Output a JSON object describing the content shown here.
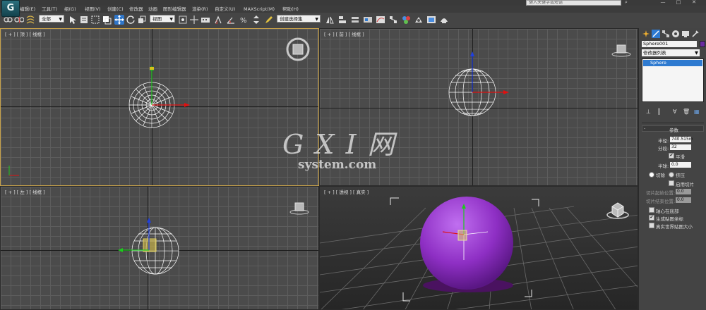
{
  "titlebar": {
    "search_placeholder": "键入关键字或短语",
    "win_min": "—",
    "win_max": "□",
    "win_close": "✕"
  },
  "menu": [
    "编辑(E)",
    "工具(T)",
    "组(G)",
    "视图(V)",
    "创建(C)",
    "修改器",
    "动画",
    "图形编辑器",
    "渲染(R)",
    "自定义(U)",
    "MAXScript(M)",
    "帮助(H)"
  ],
  "toolbar": {
    "selection_filter": "全部",
    "reference_coord": "视图",
    "named_selection": "创建选择集"
  },
  "viewports": {
    "top": "[ + ] [ 顶 ] [ 线框 ]",
    "front": "[ + ] [ 前 ] [ 线框 ]",
    "left": "[ + ] [ 左 ] [ 线框 ]",
    "perspective": "[ + ] [ 透视 ] [ 真实 ]"
  },
  "command_panel": {
    "object_name": "Sphere001",
    "object_color": "#6a2aa0",
    "modifier_list": "修改器列表",
    "stack_item": "Sphere",
    "rollout_title": "参数",
    "radius_label": "半径:",
    "radius_value": "740.515m",
    "segments_label": "分段:",
    "segments_value": "32",
    "smooth_label": "平滑",
    "smooth_checked": true,
    "hemisphere_label": "半球:",
    "hemisphere_value": "0.0",
    "chop_label": "切除",
    "squash_label": "挤压",
    "slice_on_label": "启用切片",
    "slice_from_label": "切片起始位置:",
    "slice_from_value": "0.0",
    "slice_to_label": "切片结束位置:",
    "slice_to_value": "0.0",
    "base_pivot_label": "轴心在底部",
    "gen_map_label": "生成贴图坐标",
    "gen_map_checked": true,
    "real_world_label": "真实世界贴图大小",
    "real_world_checked": false
  },
  "watermark": {
    "line1": "G X I 网",
    "line2": "system.com"
  },
  "colors": {
    "sphere_fill": "#8e2fc4",
    "active_border": "#c8a24a",
    "axis_x": "#e01010",
    "axis_y": "#1ec81e",
    "axis_z": "#2040e0"
  }
}
